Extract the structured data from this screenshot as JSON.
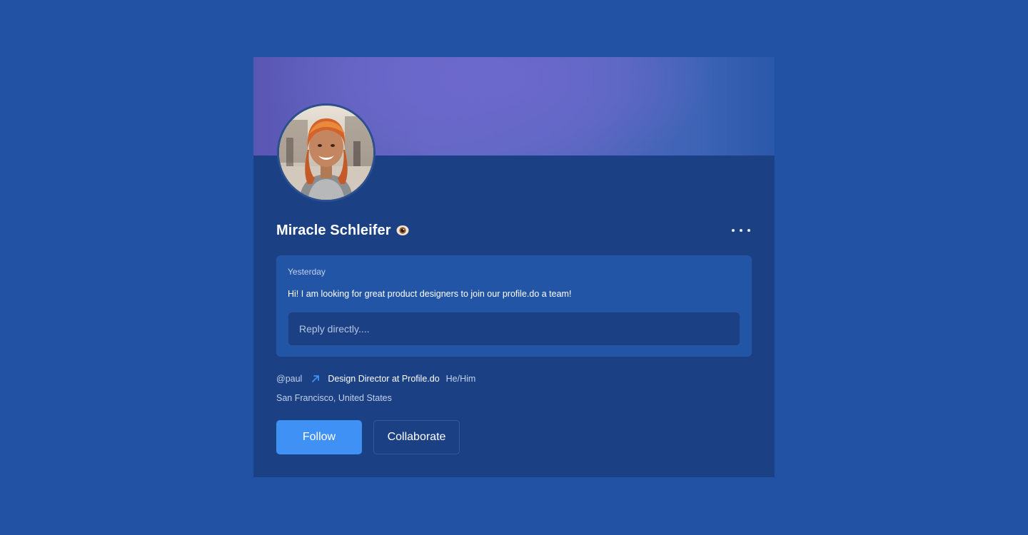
{
  "profile": {
    "name": "Miracle Schleifer",
    "name_emoji": "eye-icon",
    "avatar": "avatar-photo",
    "more_menu_icon": "more-horizontal-icon"
  },
  "message": {
    "date": "Yesterday",
    "text": "Hi! I am looking for great product designers to join our profile.do a team!",
    "reply_placeholder": "Reply directly....",
    "reply_value": ""
  },
  "meta": {
    "handle": "@paul",
    "link_icon": "arrow-up-right-icon",
    "role": "Design Director at Profile.do",
    "pronouns": "He/Him",
    "location": "San Francisco, United States"
  },
  "actions": {
    "follow_label": "Follow",
    "collaborate_label": "Collaborate"
  },
  "colors": {
    "page_background": "#2152a3",
    "card_background": "#1b4083",
    "message_background": "#2255a6",
    "primary_button": "#3f91f5",
    "link_arrow": "#3f91f5"
  }
}
